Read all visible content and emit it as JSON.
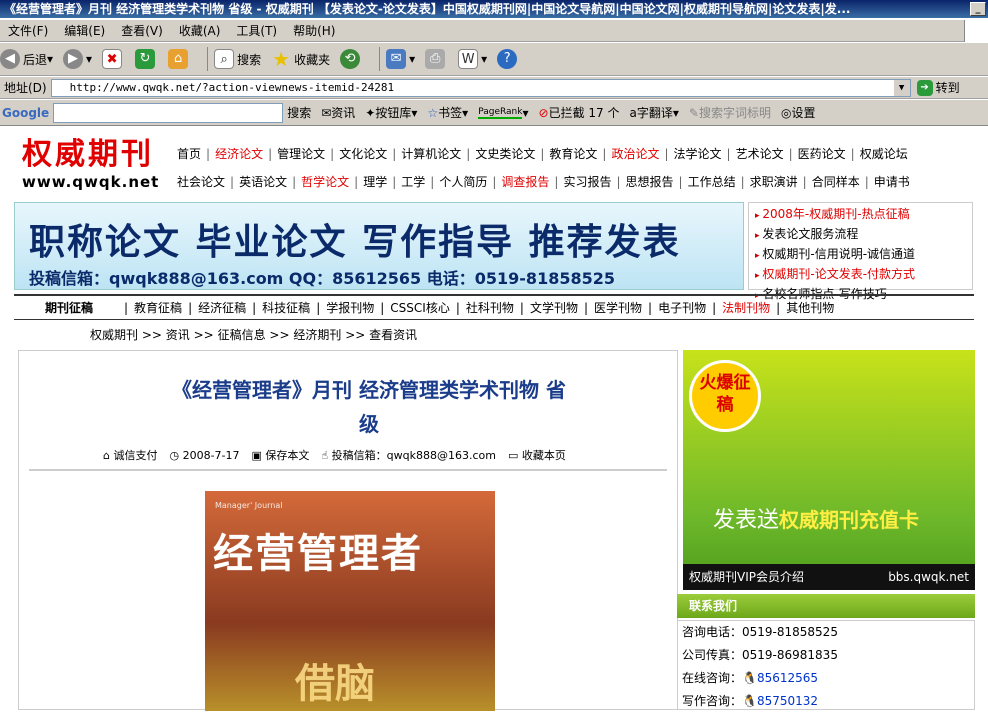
{
  "window": {
    "title": "《经营管理者》月刊 经济管理类学术刊物 省级 - 权威期刊 【发表论文-论文发表】中国权威期刊网|中国论文导航网|中国论文网|权威期刊导航网|论文发表|发..."
  },
  "menu": [
    "文件(F)",
    "编辑(E)",
    "查看(V)",
    "收藏(A)",
    "工具(T)",
    "帮助(H)"
  ],
  "toolbar": {
    "back": "后退",
    "search": "搜索",
    "favorites": "收藏夹"
  },
  "address": {
    "label": "地址(D)",
    "url": "http://www.qwqk.net/?action-viewnews-itemid-24281",
    "go": "转到"
  },
  "googlebar": {
    "brand": "Google",
    "search": "搜索",
    "news": "资讯",
    "buttons": "按钮库",
    "bookmarks": "书签",
    "pagerank": "PageRank",
    "blocked": "已拦截 17 个",
    "translate": "翻译",
    "highlight": "搜索字词标明",
    "settings": "设置"
  },
  "site": {
    "logo_cn": "权威期刊",
    "logo_en": "www.qwqk.net",
    "nav_row1": [
      "首页",
      "经济论文",
      "管理论文",
      "文化论文",
      "计算机论文",
      "文史类论文",
      "教育论文",
      "政治论文",
      "法学论文",
      "艺术论文",
      "医药论文",
      "权威论坛"
    ],
    "nav_row2": [
      "社会论文",
      "英语论文",
      "哲学论文",
      "理学",
      "工学",
      "个人简历",
      "调查报告",
      "实习报告",
      "思想报告",
      "工作总结",
      "求职演讲",
      "合同样本",
      "申请书"
    ],
    "banner_headline": "职称论文 毕业论文 写作指导 推荐发表",
    "banner_contact": "投稿信箱：qwqk888@163.com   QQ：85612565   电话：0519-81858525",
    "news": [
      "2008年-权威期刊-热点征稿",
      "发表论文服务流程",
      "权威期刊-信用说明-诚信通道",
      "权威期刊-论文发表-付款方式",
      "名校名师指点-写作技巧"
    ],
    "journal_bar_title": "期刊征稿",
    "journal_bar": [
      "教育征稿",
      "经济征稿",
      "科技征稿",
      "学报刊物",
      "CSSCI核心",
      "社科刊物",
      "文学刊物",
      "医学刊物",
      "电子刊物",
      "法制刊物",
      "其他刊物"
    ],
    "breadcrumb": [
      "权威期刊",
      "资讯",
      "征稿信息",
      "经济期刊",
      "查看资讯"
    ],
    "breadcrumb_sep": ">>"
  },
  "article": {
    "title_line1": "《经营管理者》月刊 经济管理类学术刊物 省",
    "title_line2": "级",
    "meta_trust": "诚信支付",
    "meta_date": "2008-7-17",
    "meta_save": "保存本文",
    "meta_email": "投稿信箱：qwqk888@163.com",
    "meta_fav": "收藏本页",
    "cover_title": "经营管理者",
    "cover_top": "Manager' Journal",
    "cover_bottom": "借脑"
  },
  "ad": {
    "badge": "火爆征稿",
    "slogan_prefix": "发表送",
    "slogan_emph": "权威期刊充值卡",
    "foot_left": "权威期刊VIP会员介绍",
    "foot_right": "bbs.qwqk.net"
  },
  "contact": {
    "heading": "联系我们",
    "phone": "咨询电话：0519-81858525",
    "fax": "公司传真：0519-86981835",
    "online_label": "在线咨询：",
    "online_qq": "85612565",
    "write_label": "写作咨询：",
    "write_qq": "85750132"
  },
  "colors": {
    "brand_red": "#e00000",
    "title_blue": "#1a3c8a",
    "ad_green": "#6db82a"
  }
}
